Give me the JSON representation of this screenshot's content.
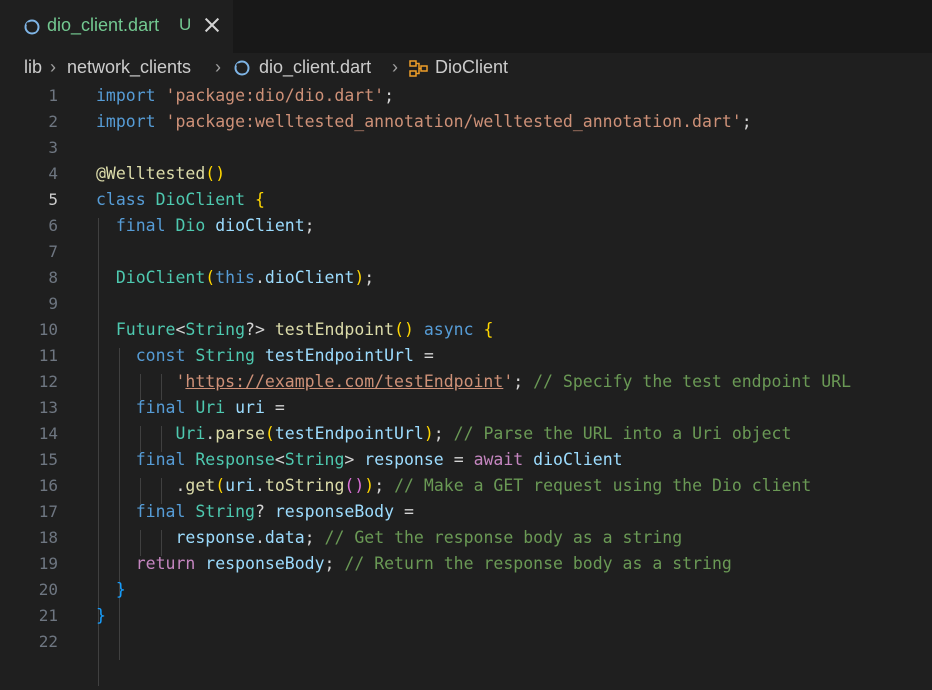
{
  "tab": {
    "file_name": "dio_client.dart",
    "status": "U",
    "icon": "dart-icon"
  },
  "breadcrumb": {
    "folder1": "lib",
    "folder2": "network_clients",
    "file": "dio_client.dart",
    "symbol": "DioClient"
  },
  "editor": {
    "current_line": 5,
    "lines": [
      "import 'package:dio/dio.dart';",
      "import 'package:welltested_annotation/welltested_annotation.dart';",
      "",
      "@Welltested()",
      "class DioClient {",
      "  final Dio dioClient;",
      "",
      "  DioClient(this.dioClient);",
      "",
      "  Future<String?> testEndpoint() async {",
      "    const String testEndpointUrl =",
      "        'https://example.com/testEndpoint'; // Specify the test endpoint URL",
      "    final Uri uri =",
      "        Uri.parse(testEndpointUrl); // Parse the URL into a Uri object",
      "    final Response<String> response = await dioClient",
      "        .get(uri.toString()); // Make a GET request using the Dio client",
      "    final String? responseBody =",
      "        response.data; // Get the response body as a string",
      "    return responseBody; // Return the response body as a string",
      "  }",
      "}",
      ""
    ],
    "line_numbers": [
      "1",
      "2",
      "3",
      "4",
      "5",
      "6",
      "7",
      "8",
      "9",
      "10",
      "11",
      "12",
      "13",
      "14",
      "15",
      "16",
      "17",
      "18",
      "19",
      "20",
      "21",
      "22"
    ]
  }
}
